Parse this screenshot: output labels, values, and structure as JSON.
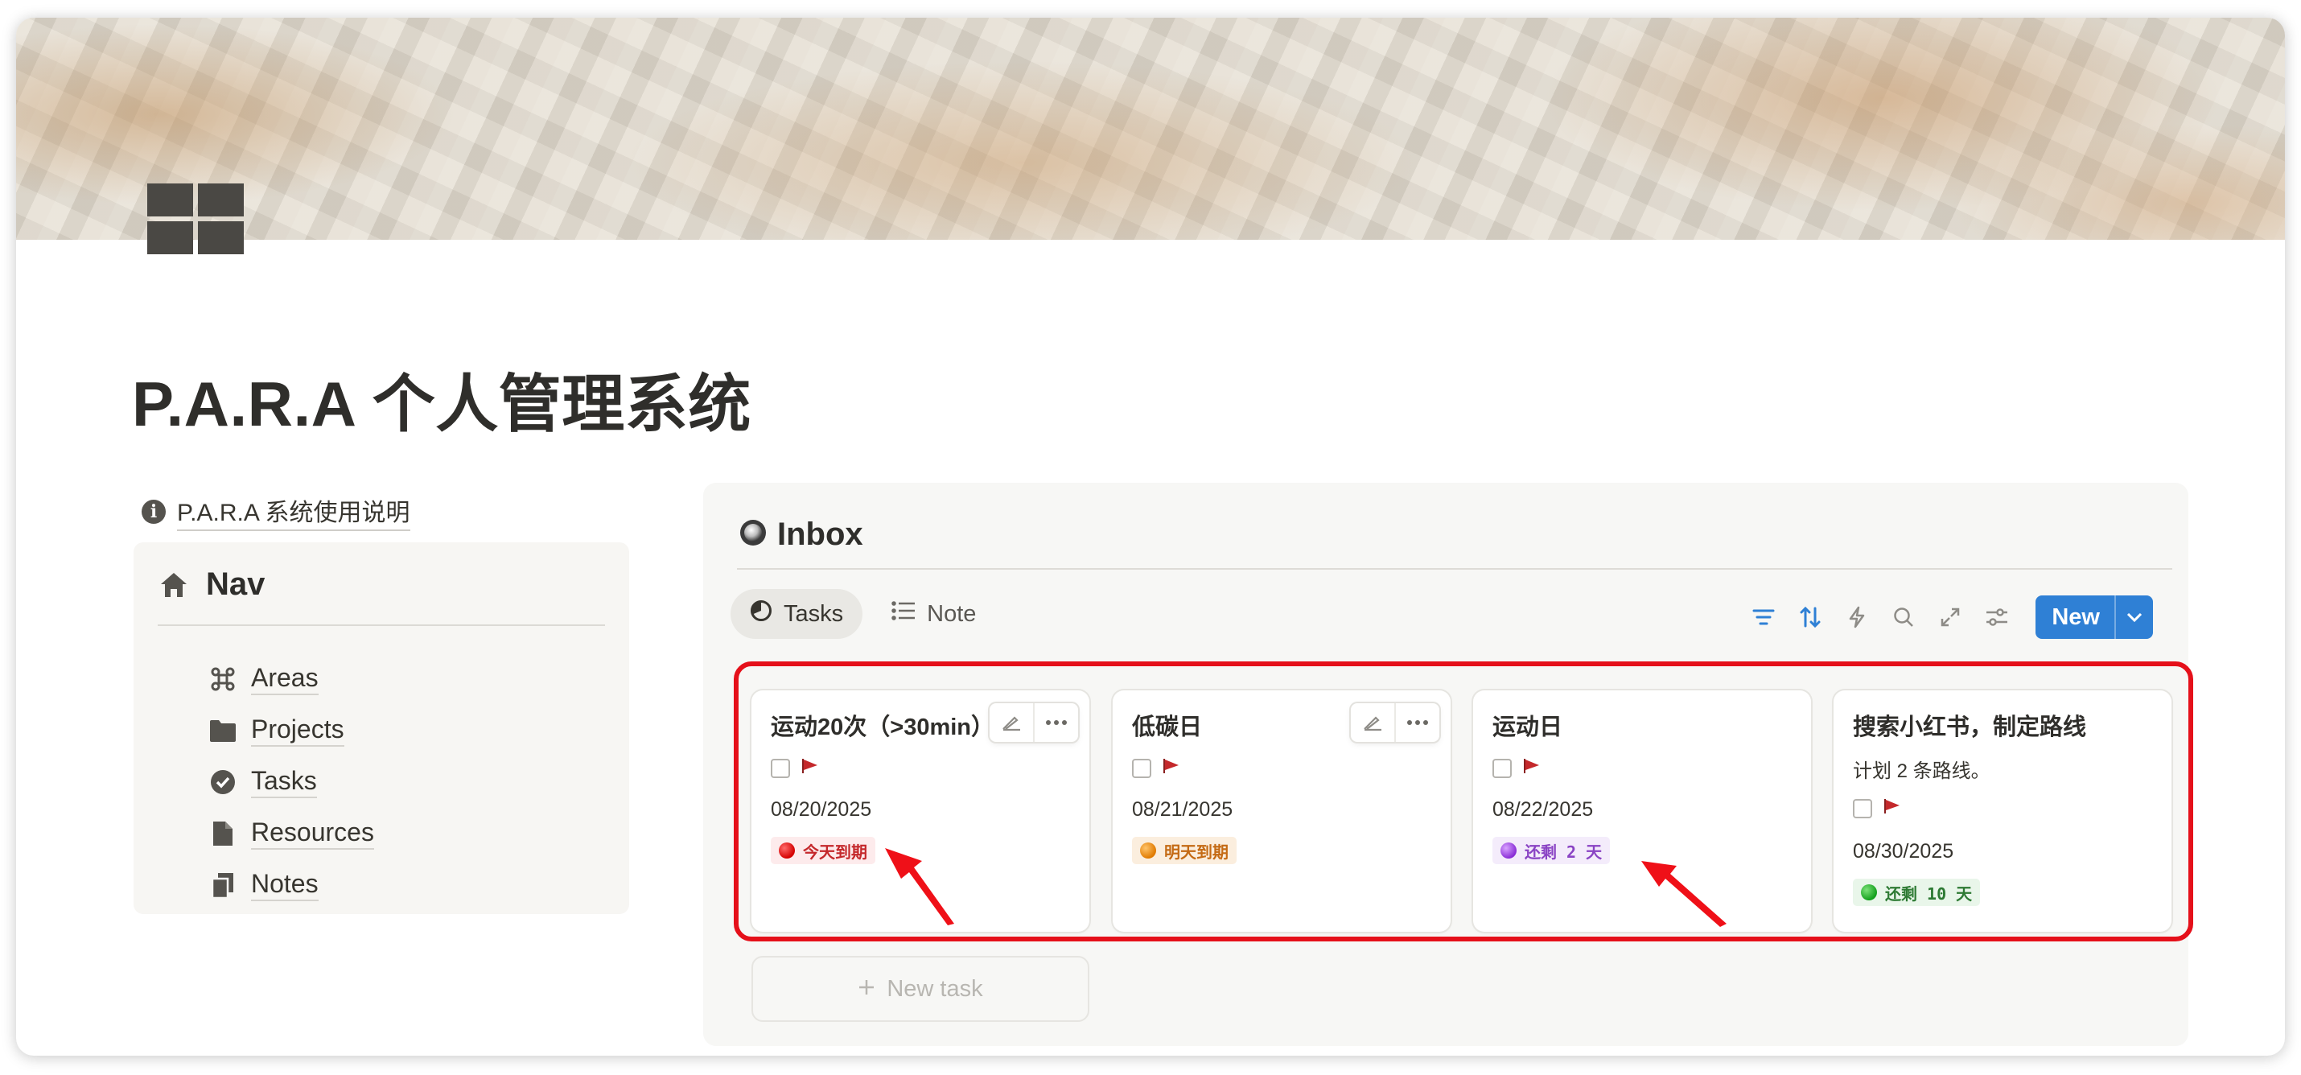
{
  "page": {
    "title": "P.A.R.A 个人管理系统",
    "icon": "grid-icon"
  },
  "guide_link": {
    "label": "P.A.R.A 系统使用说明",
    "icon": "info-icon"
  },
  "nav": {
    "heading": "Nav",
    "icon": "home-icon",
    "items": [
      {
        "label": "Areas",
        "icon": "command-icon"
      },
      {
        "label": "Projects",
        "icon": "folder-icon"
      },
      {
        "label": "Tasks",
        "icon": "check-circle-icon"
      },
      {
        "label": "Resources",
        "icon": "document-icon"
      },
      {
        "label": "Notes",
        "icon": "copy-icon"
      }
    ]
  },
  "inbox": {
    "heading": "Inbox",
    "icon": "inbox-sphere-icon",
    "tabs": [
      {
        "label": "Tasks",
        "icon": "pie-chart-icon",
        "active": true
      },
      {
        "label": "Note",
        "icon": "list-icon",
        "active": false
      }
    ],
    "toolbar": {
      "icons": [
        "filter-icon",
        "sort-icon",
        "lightning-icon",
        "search-icon",
        "expand-icon",
        "settings-icon"
      ],
      "new_label": "New",
      "accent": "#2f80d5"
    },
    "cards": [
      {
        "title": "运动20次（>30min）",
        "description": "",
        "date": "08/20/2025",
        "badge": "今天到期",
        "badge_color": "#e03e3e",
        "flag_color": "#c4282b",
        "actions_visible": true
      },
      {
        "title": "低碳日",
        "description": "",
        "date": "08/21/2025",
        "badge": "明天到期",
        "badge_color": "#e5921c",
        "flag_color": "#c4282b",
        "actions_visible": true
      },
      {
        "title": "运动日",
        "description": "",
        "date": "08/22/2025",
        "badge": "还剩 2 天",
        "badge_color": "#9b4fd6",
        "flag_color": "#c4282b",
        "actions_visible": false
      },
      {
        "title": "搜索小红书，制定路线",
        "description": "计划 2 条路线。",
        "date": "08/30/2025",
        "badge": "还剩 10 天",
        "badge_color": "#2eaa3c",
        "flag_color": "#c4282b",
        "actions_visible": false
      }
    ],
    "new_task_label": "New task"
  },
  "annotation": {
    "highlight_color": "#e5101a"
  }
}
